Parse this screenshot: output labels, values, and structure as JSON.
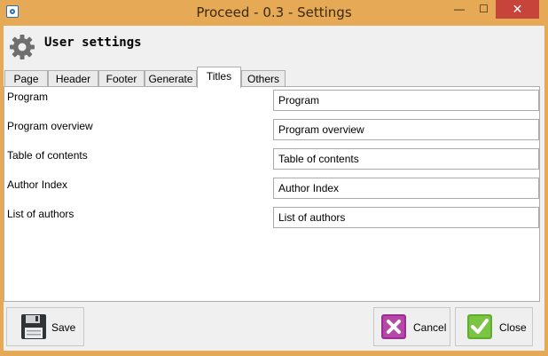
{
  "window": {
    "title": "Proceed - 0.3 - Settings",
    "controls": {
      "minimize": "—",
      "maximize": "☐",
      "close": "✕"
    }
  },
  "header": {
    "title": "User settings",
    "icon": "gear-icon"
  },
  "tabs": [
    {
      "label": "Page"
    },
    {
      "label": "Header"
    },
    {
      "label": "Footer"
    },
    {
      "label": "Generate"
    },
    {
      "label": "Titles",
      "active": true
    },
    {
      "label": "Others"
    }
  ],
  "fields": [
    {
      "label": "Program",
      "value": "Program"
    },
    {
      "label": "Program overview",
      "value": "Program overview"
    },
    {
      "label": "Table of contents",
      "value": "Table of contents"
    },
    {
      "label": "Author Index",
      "value": "Author Index"
    },
    {
      "label": "List of authors",
      "value": "List of authors"
    }
  ],
  "buttons": {
    "save": "Save",
    "cancel": "Cancel",
    "close": "Close"
  },
  "colors": {
    "titlebar": "#e6a956",
    "close_button": "#c7443a",
    "cancel_icon": "#9b2f8f",
    "close_icon": "#5fae2e"
  }
}
